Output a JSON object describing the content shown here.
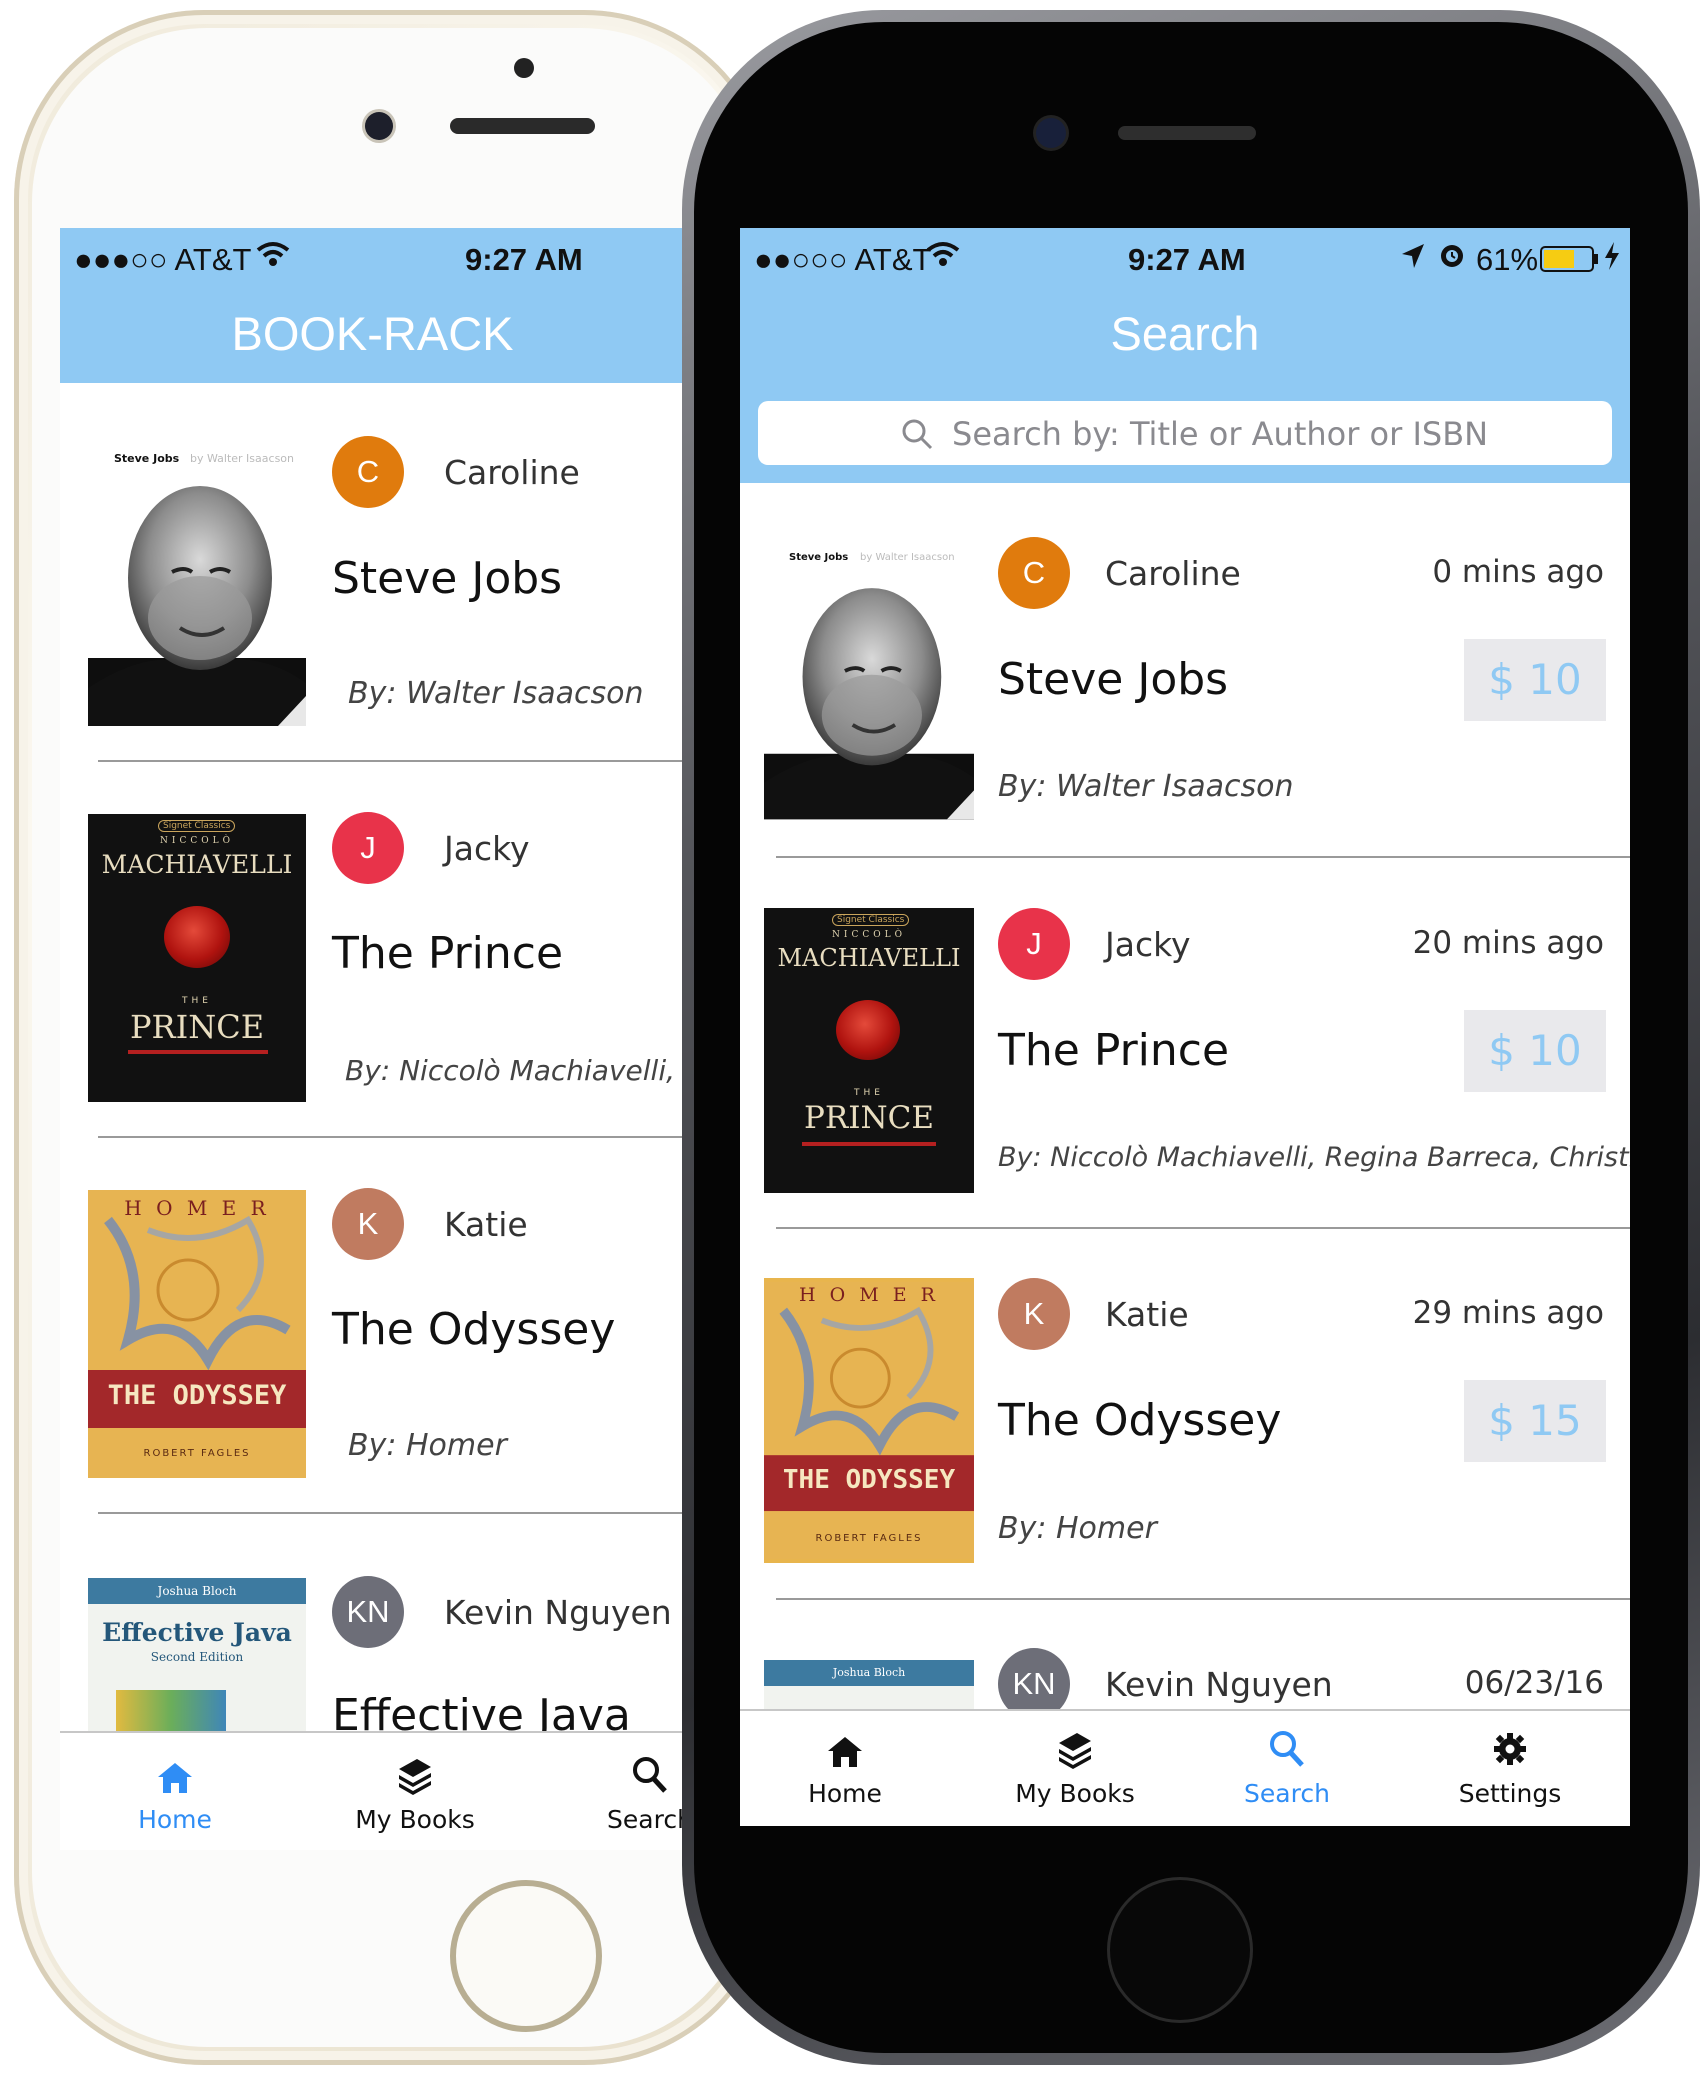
{
  "left_phone": {
    "status": {
      "carrier": "●●●○○ AT&T",
      "time": "9:27 AM"
    },
    "title": "BOOK-RACK",
    "rows": [
      {
        "avatar": "C",
        "avatar_color": "#e07b0d",
        "user": "Caroline",
        "title": "Steve Jobs",
        "author": "By: Walter Isaacson"
      },
      {
        "avatar": "J",
        "avatar_color": "#e8334a",
        "user": "Jacky",
        "title": "The Prince",
        "author": "By: Niccolò Machiavelli, Regin"
      },
      {
        "avatar": "K",
        "avatar_color": "#c07b60",
        "user": "Katie",
        "title": "The Odyssey",
        "author": "By: Homer"
      },
      {
        "avatar": "KN",
        "avatar_color": "#6d6e78",
        "user": "Kevin Nguyen",
        "title": "Effective Java"
      }
    ],
    "tabs": [
      {
        "label": "Home",
        "active": true
      },
      {
        "label": "My Books",
        "active": false
      },
      {
        "label": "Search",
        "active": false
      }
    ]
  },
  "right_phone": {
    "status": {
      "carrier": "●●○○○ AT&T",
      "time": "9:27 AM",
      "battery": "61%"
    },
    "title": "Search",
    "search_placeholder": "Search by: Title or Author or ISBN",
    "rows": [
      {
        "avatar": "C",
        "avatar_color": "#e07b0d",
        "user": "Caroline",
        "time": "0 mins ago",
        "title": "Steve Jobs",
        "price": "$ 10",
        "author": "By: Walter Isaacson"
      },
      {
        "avatar": "J",
        "avatar_color": "#e8334a",
        "user": "Jacky",
        "time": "20 mins ago",
        "title": "The Prince",
        "price": "$ 10",
        "author": "By: Niccolò Machiavelli, Regina Barreca, Christian Ga..."
      },
      {
        "avatar": "K",
        "avatar_color": "#c07b60",
        "user": "Katie",
        "time": "29 mins ago",
        "title": "The Odyssey",
        "price": "$ 15",
        "author": "By: Homer"
      },
      {
        "avatar": "KN",
        "avatar_color": "#6d6e78",
        "user": "Kevin Nguyen",
        "time": "06/23/16"
      }
    ],
    "tabs": [
      {
        "label": "Home",
        "active": false
      },
      {
        "label": "My Books",
        "active": false
      },
      {
        "label": "Search",
        "active": true
      },
      {
        "label": "Settings",
        "active": false
      }
    ]
  },
  "covers": {
    "steve_jobs": {
      "header": "Steve Jobs",
      "sub": "by Walter Isaacson"
    },
    "prince": {
      "top": "Signet Classics",
      "name_small": "NICCOLÒ",
      "name": "MACHIAVELLI",
      "the": "THE",
      "title": "PRINCE"
    },
    "odyssey": {
      "author": "H O M E R",
      "title": "THE ODYSSEY",
      "translator": "ROBERT FAGLES"
    },
    "java": {
      "author": "Joshua Bloch",
      "title": "Effective Java",
      "edition": "Second Edition"
    }
  },
  "colors": {
    "nav": "#8fc9f3",
    "active_tab": "#2f8df5",
    "price_text": "#8fc9f3"
  }
}
